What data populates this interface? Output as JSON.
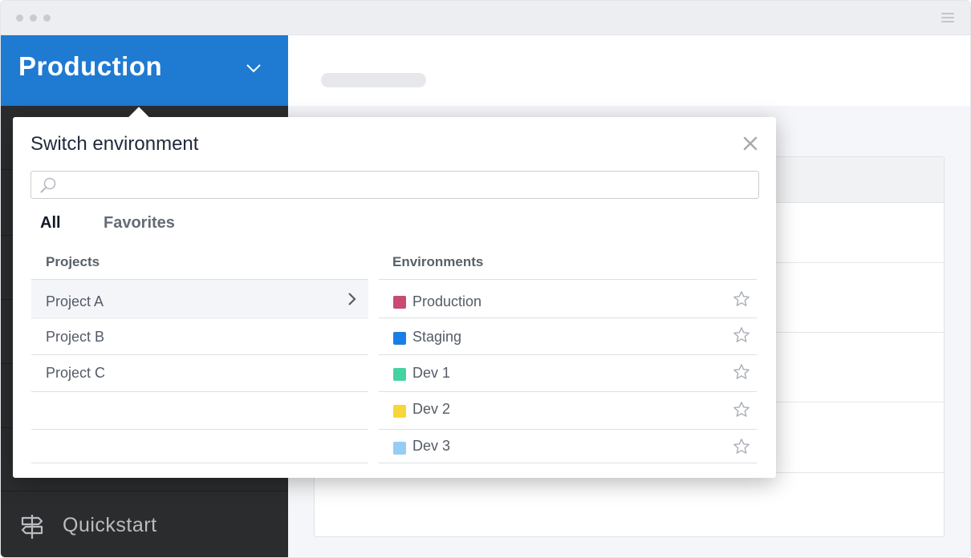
{
  "sidebar": {
    "environment": "Production",
    "quickstart_label": "Quickstart"
  },
  "popover": {
    "title": "Switch environment",
    "search": {
      "value": "",
      "placeholder": ""
    },
    "tabs": [
      {
        "label": "All",
        "active": true
      },
      {
        "label": "Favorites",
        "active": false
      }
    ],
    "projects_header": "Projects",
    "environments_header": "Environments",
    "projects": [
      {
        "label": "Project A",
        "selected": true
      },
      {
        "label": "Project B",
        "selected": false
      },
      {
        "label": "Project C",
        "selected": false
      }
    ],
    "environments": [
      {
        "label": "Production",
        "color": "#c94a73"
      },
      {
        "label": "Staging",
        "color": "#1a7ee6"
      },
      {
        "label": "Dev 1",
        "color": "#45d3a2"
      },
      {
        "label": "Dev 2",
        "color": "#f7d63a"
      },
      {
        "label": "Dev 3",
        "color": "#95cdf5"
      }
    ]
  },
  "icons": {
    "close": "close-icon",
    "search": "search-icon",
    "chevron": "chevron-down-icon",
    "star": "star-icon",
    "signpost": "signpost-icon",
    "menu": "hamburger-icon"
  }
}
